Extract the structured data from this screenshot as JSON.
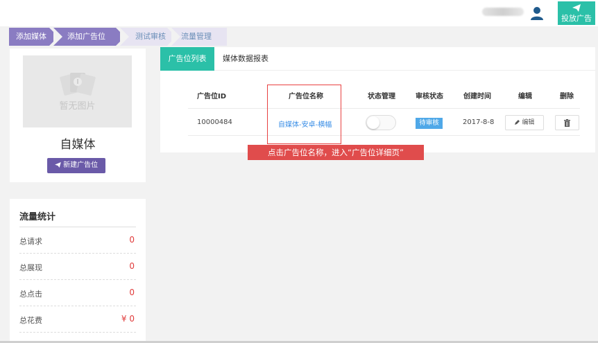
{
  "header": {
    "publish_button_label": "投放广告"
  },
  "steps": [
    {
      "label": "添加媒体",
      "state": "done"
    },
    {
      "label": "添加广告位",
      "state": "done"
    },
    {
      "label": "测试审核",
      "state": "todo"
    },
    {
      "label": "流量管理",
      "state": "todo"
    }
  ],
  "profile": {
    "image_placeholder": "暂无图片",
    "media_name": "自媒体",
    "new_slot_button": "新建广告位"
  },
  "stats": {
    "title": "流量统计",
    "rows": [
      {
        "label": "总请求",
        "value": "0"
      },
      {
        "label": "总展现",
        "value": "0"
      },
      {
        "label": "总点击",
        "value": "0"
      },
      {
        "label": "总花费",
        "value": "¥ 0"
      }
    ]
  },
  "tabs": [
    {
      "label": "广告位列表",
      "active": true
    },
    {
      "label": "媒体数据报表",
      "active": false
    }
  ],
  "table": {
    "headers": [
      "广告位ID",
      "广告位名称",
      "状态管理",
      "审核状态",
      "创建时间",
      "编辑",
      "删除"
    ],
    "rows": [
      {
        "id": "10000484",
        "name": "自媒体-安卓-横幅",
        "toggle_on": false,
        "review_status": "待审核",
        "created": "2017-8-8",
        "edit_label": "编辑"
      }
    ]
  },
  "annotation": {
    "text": "点击广告位名称，进入“广告位详细页”"
  },
  "colors": {
    "accent": "#2bc0a8",
    "step_done": "#8a7cc2",
    "primary_button": "#6a5aa8",
    "badge": "#4fa8e8",
    "annotation_red": "#e04c4c",
    "stat_value": "#e03b3b"
  }
}
